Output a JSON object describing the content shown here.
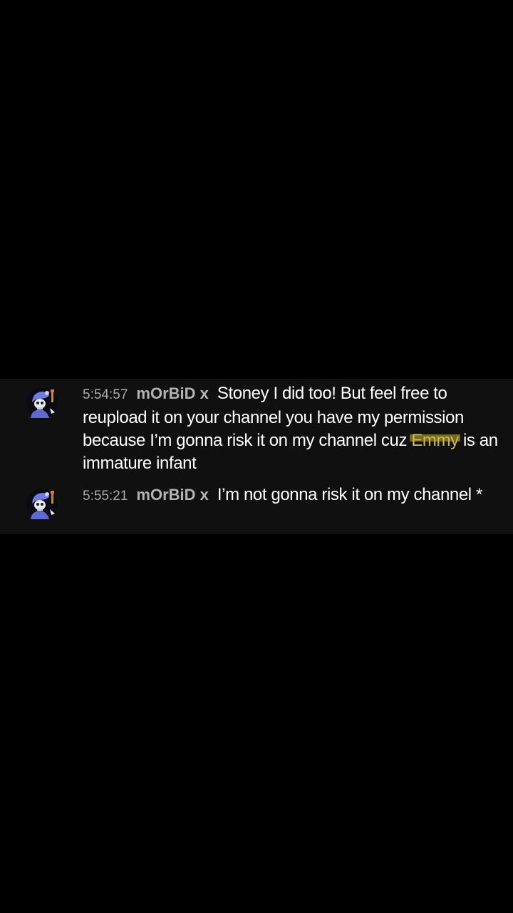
{
  "chat": {
    "messages": [
      {
        "timestamp": "5:54:57",
        "author": "mOrBiD x",
        "text_before": "Stoney I did too! But feel free to reupload it on your channel you have my permission because I’m gonna risk it on my channel cuz ",
        "redacted_word": "Emmy",
        "text_after": " is an immature infant",
        "avatar_icon": "skeleton-avatar-icon"
      },
      {
        "timestamp": "5:55:21",
        "author": "mOrBiD x",
        "text_before": "I’m not gonna risk it on my channel *",
        "redacted_word": "",
        "text_after": "",
        "avatar_icon": "skeleton-avatar-icon"
      }
    ]
  },
  "colors": {
    "page_background": "#000000",
    "panel_background": "#101010",
    "message_text": "#ffffff",
    "timestamp": "#aaaaaa",
    "author": "#b3b3b3",
    "highlight": "#8c7a1e"
  }
}
